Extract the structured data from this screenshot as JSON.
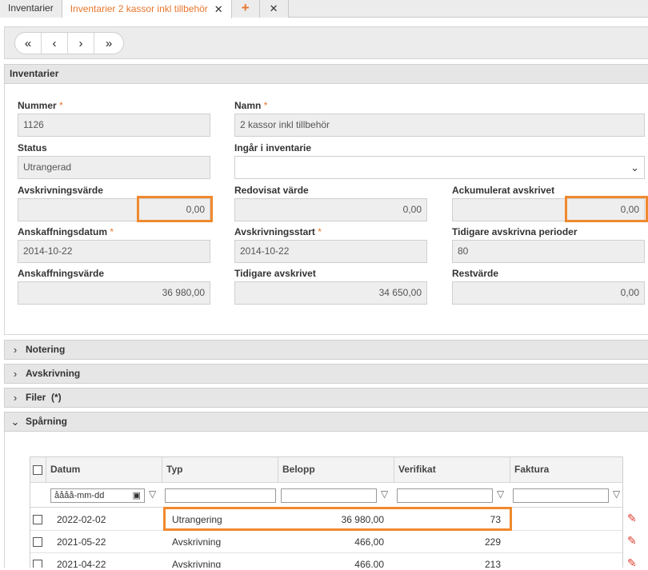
{
  "tabs": [
    {
      "label": "Inventarier"
    },
    {
      "label": "Inventarier 2 kassor inkl tillbehör"
    }
  ],
  "tab_add": "+",
  "tab_close_all": "✕",
  "nav": {
    "first": "«",
    "prev": "‹",
    "next": "›",
    "last": "»"
  },
  "panel_title": "Inventarier",
  "fields": {
    "nummer": {
      "label": "Nummer",
      "value": "1126"
    },
    "namn": {
      "label": "Namn",
      "value": "2 kassor inkl tillbehör"
    },
    "status": {
      "label": "Status",
      "value": "Utrangerad"
    },
    "ingar": {
      "label": "Ingår i inventarie",
      "value": ""
    },
    "avskrivningsvarde": {
      "label": "Avskrivningsvärde",
      "value": "0,00"
    },
    "redovisat": {
      "label": "Redovisat värde",
      "value": "0,00"
    },
    "ackumulerat": {
      "label": "Ackumulerat avskrivet",
      "value": "0,00"
    },
    "anskaffningsdatum": {
      "label": "Anskaffningsdatum",
      "value": "2014-10-22"
    },
    "avskrivningsstart": {
      "label": "Avskrivningsstart",
      "value": "2014-10-22"
    },
    "tidigare_perioder": {
      "label": "Tidigare avskrivna perioder",
      "value": "80"
    },
    "anskaffningsvarde": {
      "label": "Anskaffningsvärde",
      "value": "36 980,00"
    },
    "tidigare_avskrivet": {
      "label": "Tidigare avskrivet",
      "value": "34 650,00"
    },
    "restvarde": {
      "label": "Restvärde",
      "value": "0,00"
    }
  },
  "required_mark": "*",
  "sections": {
    "notering": "Notering",
    "avskrivning": "Avskrivning",
    "filer": "Filer  (*)",
    "sparning": "Spårning"
  },
  "grid": {
    "columns": [
      "Datum",
      "Typ",
      "Belopp",
      "Verifikat",
      "Faktura"
    ],
    "date_placeholder": "åååå-mm-dd",
    "rows": [
      {
        "datum": "2022-02-02",
        "typ": "Utrangering",
        "belopp": "36 980,00",
        "verifikat": "73",
        "faktura": ""
      },
      {
        "datum": "2021-05-22",
        "typ": "Avskrivning",
        "belopp": "466,00",
        "verifikat": "229",
        "faktura": ""
      },
      {
        "datum": "2021-04-22",
        "typ": "Avskrivning",
        "belopp": "466,00",
        "verifikat": "213",
        "faktura": ""
      }
    ]
  },
  "icons": {
    "chevron": "chevron-down-icon",
    "filter": "funnel-icon",
    "edit": "pencil-icon",
    "calendar": "calendar-icon"
  },
  "colors": {
    "accent": "#e8762d",
    "highlight": "#f0892e",
    "edit": "#e03c2c"
  }
}
